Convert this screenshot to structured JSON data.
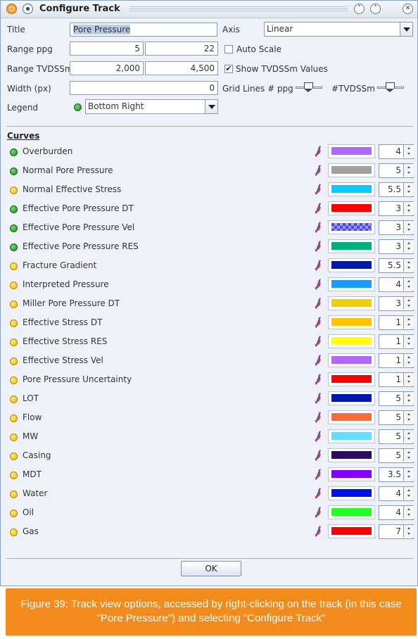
{
  "window": {
    "title": "Configure Track"
  },
  "form": {
    "title_label": "Title",
    "title_value": "Pore Pressure",
    "axis_label": "Axis",
    "axis_value": "Linear",
    "range_ppg_label": "Range  ppg",
    "range_ppg_min": "5",
    "range_ppg_max": "22",
    "auto_scale_label": "Auto Scale",
    "auto_scale_checked": false,
    "range_tvdssm_label": "Range TVDSSm",
    "range_tvdssm_min": "2,000",
    "range_tvdssm_max": "4,500",
    "show_tvdssm_label": "Show TVDSSm Values",
    "show_tvdssm_checked": true,
    "width_label": "Width (px)",
    "width_value": "0",
    "grid_lines_label": "Grid Lines # ppg",
    "tvdssm_slider_label": "#TVDSSm",
    "legend_label": "Legend",
    "legend_value": "Bottom Right"
  },
  "curves": {
    "heading": "Curves",
    "items": [
      {
        "name": "Overburden",
        "status": "green",
        "color": "#b266ff",
        "width": "4"
      },
      {
        "name": "Normal Pore Pressure",
        "status": "green",
        "color": "#a0a0a0",
        "width": "5"
      },
      {
        "name": "Normal Effective Stress",
        "status": "yellow",
        "color": "#00ccff",
        "width": "5.5"
      },
      {
        "name": "Effective Pore Pressure DT",
        "status": "green",
        "color": "#ff0000",
        "width": "3"
      },
      {
        "name": "Effective Pore Pressure Vel",
        "status": "green",
        "color": "#4a4ae8",
        "pattern": "checker",
        "width": "3"
      },
      {
        "name": "Effective Pore Pressure RES",
        "status": "green",
        "color": "#00b07a",
        "width": "3"
      },
      {
        "name": "Fracture Gradient",
        "status": "yellow",
        "color": "#0018b0",
        "width": "5.5"
      },
      {
        "name": "Interpreted Pressure",
        "status": "yellow",
        "color": "#1a9cff",
        "width": "4"
      },
      {
        "name": "Miller Pore Pressure DT",
        "status": "yellow",
        "color": "#f0d000",
        "width": "3"
      },
      {
        "name": "Effective Stress DT",
        "status": "yellow",
        "color": "#ffc400",
        "width": "1"
      },
      {
        "name": "Effective Stress RES",
        "status": "yellow",
        "color": "#ffff00",
        "width": "1"
      },
      {
        "name": "Effective Stress Vel",
        "status": "yellow",
        "color": "#b266ff",
        "width": "1"
      },
      {
        "name": "Pore Pressure Uncertainty",
        "status": "yellow",
        "color": "#ff0000",
        "width": "1"
      },
      {
        "name": "LOT",
        "status": "yellow",
        "color": "#0018b0",
        "width": "5"
      },
      {
        "name": "Flow",
        "status": "yellow",
        "color": "#ff6a33",
        "width": "5"
      },
      {
        "name": "MW",
        "status": "yellow",
        "color": "#66ddff",
        "width": "5"
      },
      {
        "name": "Casing",
        "status": "yellow",
        "color": "#2a0a66",
        "width": "5"
      },
      {
        "name": "MDT",
        "status": "yellow",
        "color": "#8000ff",
        "width": "3.5"
      },
      {
        "name": "Water",
        "status": "yellow",
        "color": "#0010ee",
        "width": "4"
      },
      {
        "name": "Oil",
        "status": "yellow",
        "color": "#22ff22",
        "width": "4"
      },
      {
        "name": "Gas",
        "status": "yellow",
        "color": "#ff0000",
        "width": "7"
      }
    ]
  },
  "ok_label": "OK",
  "caption": {
    "line1": "Figure 39: Track view options, accessed by right-clicking on the track (in this case",
    "line2": "\"Pore Pressure\") and selecting \"Configure Track\""
  },
  "colors": {
    "caption_bg": "#f38b1c",
    "window_bg": "#eef2f8"
  }
}
